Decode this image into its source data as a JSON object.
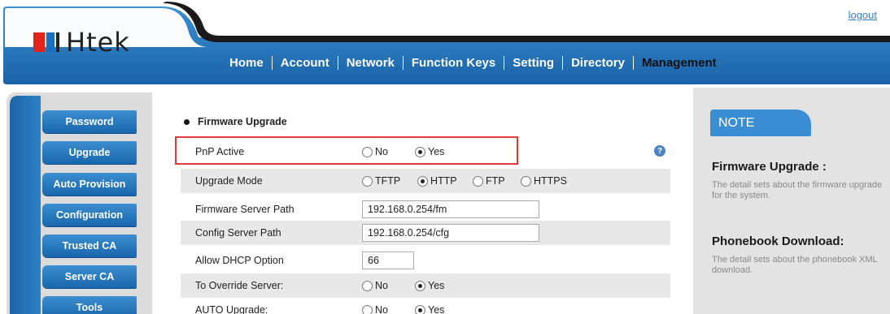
{
  "header": {
    "logout_label": "logout",
    "logo_text": "Htek",
    "nav": [
      {
        "label": "Home"
      },
      {
        "label": "Account"
      },
      {
        "label": "Network"
      },
      {
        "label": "Function Keys"
      },
      {
        "label": "Setting"
      },
      {
        "label": "Directory"
      },
      {
        "label": "Management",
        "active": true
      }
    ]
  },
  "sidebar": {
    "items": [
      {
        "label": "Password"
      },
      {
        "label": "Upgrade"
      },
      {
        "label": "Auto Provision"
      },
      {
        "label": "Configuration"
      },
      {
        "label": "Trusted CA"
      },
      {
        "label": "Server CA"
      },
      {
        "label": "Tools"
      }
    ]
  },
  "main": {
    "section_title": "Firmware Upgrade",
    "pnp_active": {
      "label": "PnP Active",
      "options": [
        "No",
        "Yes"
      ],
      "selected": "Yes"
    },
    "upgrade_mode": {
      "label": "Upgrade Mode",
      "options": [
        "TFTP",
        "HTTP",
        "FTP",
        "HTTPS"
      ],
      "selected": "HTTP"
    },
    "firmware_server_path": {
      "label": "Firmware Server Path",
      "value": "192.168.0.254/fm"
    },
    "config_server_path": {
      "label": "Config Server Path",
      "value": "192.168.0.254/cfg"
    },
    "allow_dhcp_option": {
      "label": "Allow DHCP Option",
      "value": "66"
    },
    "to_override_server": {
      "label": "To Override Server:",
      "options": [
        "No",
        "Yes"
      ],
      "selected": "Yes"
    },
    "auto_upgrade": {
      "label": "AUTO Upgrade:",
      "options": [
        "No",
        "Yes"
      ],
      "selected": "Yes"
    },
    "help_glyph": "?"
  },
  "note": {
    "tab_label": "NOTE",
    "sections": [
      {
        "heading": "Firmware Upgrade :",
        "text": "The detail sets about the firmware upgrade for the system."
      },
      {
        "heading": "Phonebook Download:",
        "text": "The detail sets about the phonebook XML download."
      }
    ]
  },
  "colors": {
    "header_dark": "#1a1a1a",
    "header_blue": "#1f6db3",
    "accent_blue": "#3b8ed4",
    "highlight_red": "#e03b3b",
    "note_bg": "#e3e3e3"
  }
}
